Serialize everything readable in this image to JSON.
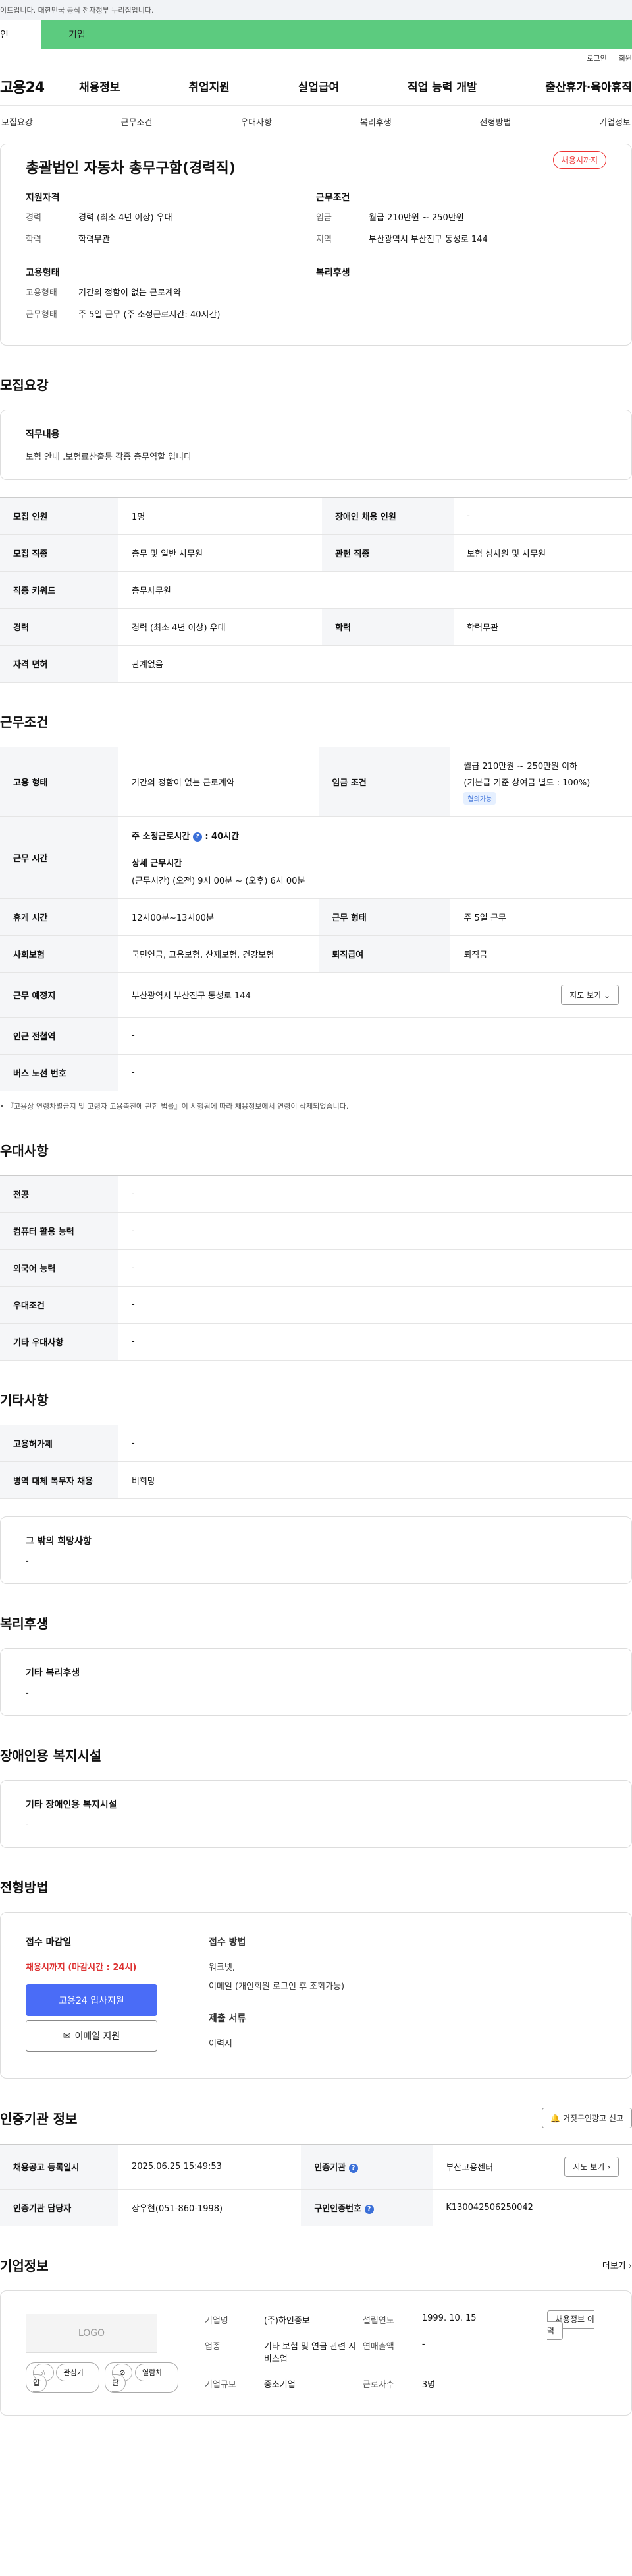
{
  "gov_bar": "이트입니다. 대한민국 공식 전자정부 누리집입니다.",
  "user_tabs": [
    "인",
    "기업"
  ],
  "util_links": [
    "로그인",
    "회원"
  ],
  "logo": "고용24",
  "gnb": [
    "채용정보",
    "취업지원",
    "실업급여",
    "직업 능력 개발",
    "출산휴가·육아휴직"
  ],
  "anchors": [
    "모집요강",
    "근무조건",
    "우대사항",
    "복리후생",
    "전형방법",
    "기업정보"
  ],
  "summary": {
    "title": "총괄법인 자동차 총무구함(경력직)",
    "status": "채용시까지",
    "blocks": [
      {
        "heading": "지원자격",
        "rows": [
          {
            "k": "경력",
            "v": "경력 (최소 4년 이상) 우대"
          },
          {
            "k": "학력",
            "v": "학력무관"
          }
        ]
      },
      {
        "heading": "근무조건",
        "rows": [
          {
            "k": "임금",
            "v": "월급 210만원 ~ 250만원"
          },
          {
            "k": "지역",
            "v": "부산광역시 부산진구 동성로 144"
          }
        ]
      },
      {
        "heading": "고용형태",
        "rows": [
          {
            "k": "고용형태",
            "v": "기간의 정함이 없는 근로계약"
          },
          {
            "k": "근무형태",
            "v": "주 5일 근무 (주 소정근로시간: 40시간)"
          }
        ]
      },
      {
        "heading": "복리후생",
        "rows": []
      }
    ]
  },
  "recruit": {
    "title": "모집요강",
    "duty_heading": "직무내용",
    "duty_text": "보험 안내 .보험료산출등 각종 총무역할 입니다",
    "rows": [
      [
        "모집 인원",
        "1명",
        "장애인 채용 인원",
        "-"
      ],
      [
        "모집 직종",
        "총무 및 일반 사무원",
        "관련 직종",
        "보험 심사원 및 사무원"
      ],
      [
        "직종 키워드",
        "총무사무원",
        "",
        ""
      ],
      [
        "경력",
        "경력 (최소 4년 이상) 우대",
        "학력",
        "학력무관"
      ],
      [
        "자격 면허",
        "관계없음",
        "",
        ""
      ]
    ]
  },
  "conditions": {
    "title": "근무조건",
    "emp_type_k": "고용 형태",
    "emp_type_v": "기간의 정함이 없는 근로계약",
    "wage_k": "임금 조건",
    "wage_v1": "월급 210만원 ~ 250만원 이하",
    "wage_v2": "(기본급 기준 상여금 별도 : 100%)",
    "wage_tag": "협의가능",
    "hours_k": "근무 시간",
    "hours_weekly": "주 소정근로시간",
    "hours_weekly_v": ": 40시간",
    "hours_detail_h": "상세 근무시간",
    "hours_detail_v": "(근무시간) (오전) 9시 00분 ~ (오후) 6시 00분",
    "rows": [
      [
        "휴게 시간",
        "12시00분~13시00분",
        "근무 형태",
        "주 5일 근무"
      ],
      [
        "사회보험",
        "국민연금, 고용보험, 산재보험, 건강보험",
        "퇴직급여",
        "퇴직금"
      ]
    ],
    "addr_k": "근무 예정지",
    "addr_v": "부산광역시 부산진구 동성로 144",
    "map_btn": "지도 보기",
    "station_k": "인근 전철역",
    "station_v": "-",
    "bus_k": "버스 노선 번호",
    "bus_v": "-",
    "note": "• 『고용상 연령차별금지 및 고령자 고용촉진에 관한 법률』이 시행됨에 따라 채용정보에서 연령이 삭제되었습니다."
  },
  "preference": {
    "title": "우대사항",
    "rows": [
      [
        "전공",
        "-"
      ],
      [
        "컴퓨터 활용 능력",
        "-"
      ],
      [
        "외국어 능력",
        "-"
      ],
      [
        "우대조건",
        "-"
      ],
      [
        "기타 우대사항",
        "-"
      ]
    ]
  },
  "etc": {
    "title": "기타사항",
    "rows": [
      [
        "고용허가제",
        "-"
      ],
      [
        "병역 대체 복무자 채용",
        "비희망"
      ]
    ],
    "box_heading": "그 밖의 희망사항",
    "box_text": "-"
  },
  "welfare": {
    "title": "복리후생",
    "heading": "기타 복리후생",
    "text": "-"
  },
  "disabled": {
    "title": "장애인용 복지시설",
    "heading": "기타 장애인용 복지시설",
    "text": "-"
  },
  "selection": {
    "title": "전형방법",
    "deadline_h": "접수 마감일",
    "deadline_v": "채용시까지 (마감시간 : 24시)",
    "apply_btn": "고용24 입사지원",
    "email_btn": "이메일 지원",
    "method_h": "접수 방법",
    "method_l1": "워크넷,",
    "method_l2": "이메일 (개인회원 로그인 후 조회가능)",
    "docs_h": "제출 서류",
    "docs_v": "이력서"
  },
  "cert": {
    "title": "인증기관 정보",
    "report_btn": "거짓구인광고 신고",
    "rows": [
      [
        "채용공고 등록일시",
        "2025.06.25 15:49:53",
        "인증기관",
        "부산고용센터"
      ],
      [
        "인증기관 담당자",
        "장우현(051-860-1998)",
        "구인인증번호",
        "K130042506250042"
      ]
    ],
    "map_btn": "지도 보기"
  },
  "company": {
    "title": "기업정보",
    "more": "더보기",
    "logo": "LOGO",
    "fav": "관심기업",
    "block": "열람차단",
    "fields": [
      [
        "기업명",
        "(주)하인중보",
        "설립연도",
        "1999. 10. 15"
      ],
      [
        "업종",
        "기타 보험 및 연금 관련 서비스업",
        "연매출액",
        "-"
      ],
      [
        "기업규모",
        "중소기업",
        "근로자수",
        "3명"
      ]
    ],
    "jobs_btn": "채용정보 이력"
  }
}
